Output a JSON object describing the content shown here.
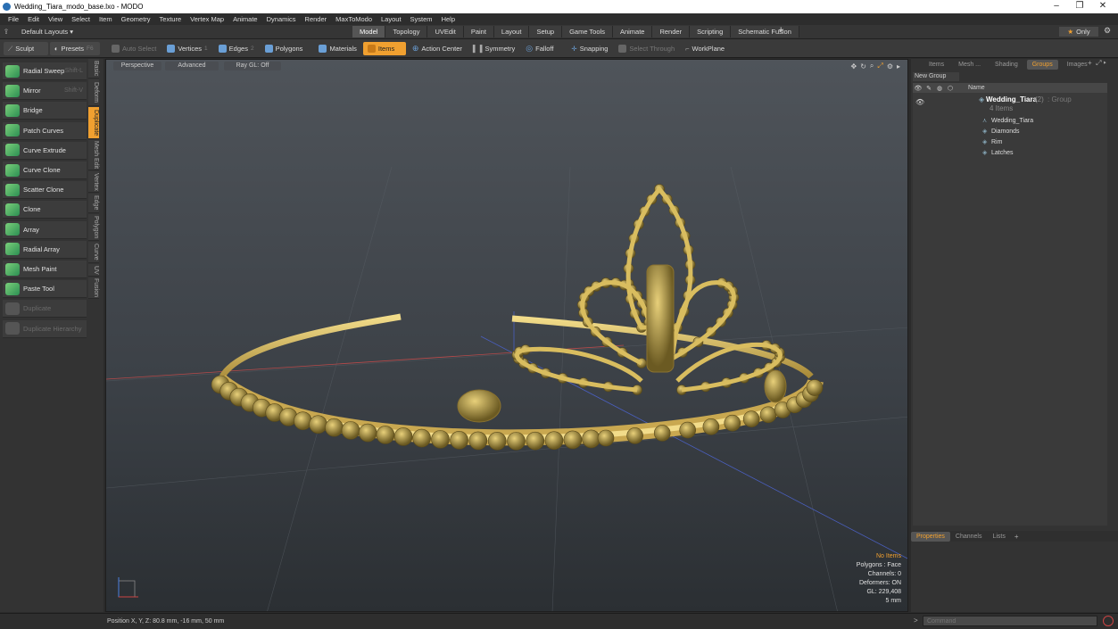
{
  "window": {
    "title": "Wedding_Tiara_modo_base.lxo - MODO"
  },
  "menu": [
    "File",
    "Edit",
    "View",
    "Select",
    "Item",
    "Geometry",
    "Texture",
    "Vertex Map",
    "Animate",
    "Dynamics",
    "Render",
    "MaxToModo",
    "Layout",
    "System",
    "Help"
  ],
  "layouts": {
    "label": "Default Layouts",
    "tabs": [
      "Model",
      "Topology",
      "UVEdit",
      "Paint",
      "Layout",
      "Setup",
      "Game Tools",
      "Animate",
      "Render",
      "Scripting",
      "Schematic Fusion"
    ],
    "active": "Model",
    "only_label": "Only"
  },
  "toolbar": {
    "sculpt": "Sculpt",
    "presets": "Presets",
    "presets_key": "F6",
    "auto_select": "Auto Select",
    "vertices": "Vertices",
    "vertices_key": "1",
    "edges": "Edges",
    "edges_key": "2",
    "polygons": "Polygons",
    "materials": "Materials",
    "items": "Items",
    "action_center": "Action Center",
    "symmetry": "Symmetry",
    "falloff": "Falloff",
    "snapping": "Snapping",
    "select_through": "Select Through",
    "workplane": "WorkPlane"
  },
  "tools": [
    {
      "label": "Radial Sweep",
      "shortcut": "Shift-L"
    },
    {
      "label": "Mirror",
      "shortcut": "Shift-V"
    },
    {
      "label": "Bridge",
      "shortcut": ""
    },
    {
      "label": "Patch Curves",
      "shortcut": ""
    },
    {
      "label": "Curve Extrude",
      "shortcut": ""
    },
    {
      "label": "Curve Clone",
      "shortcut": ""
    },
    {
      "label": "Scatter Clone",
      "shortcut": ""
    },
    {
      "label": "Clone",
      "shortcut": ""
    },
    {
      "label": "Array",
      "shortcut": ""
    },
    {
      "label": "Radial Array",
      "shortcut": ""
    },
    {
      "label": "Mesh Paint",
      "shortcut": ""
    },
    {
      "label": "Paste Tool",
      "shortcut": ""
    },
    {
      "label": "Duplicate",
      "shortcut": ""
    },
    {
      "label": "Duplicate Hierarchy",
      "shortcut": ""
    }
  ],
  "side_tabs": [
    "Basic",
    "Deform",
    "Duplicate",
    "Mesh Edit",
    "Vertex",
    "Edge",
    "Polygon",
    "Curve",
    "UV",
    "Fusion"
  ],
  "viewport": {
    "view": "Perspective",
    "mode": "Advanced",
    "raygl": "Ray GL: Off",
    "info": {
      "no_items": "No Items",
      "polygons": "Polygons : Face",
      "channels": "Channels: 0",
      "deformers": "Deformers: ON",
      "gl": "GL: 229,408",
      "scale": "5 mm"
    }
  },
  "right": {
    "tabs": [
      "Items",
      "Mesh ...",
      "Shading",
      "Groups",
      "Images"
    ],
    "active": "Groups",
    "new_group": "New Group",
    "col_name": "Name",
    "group": {
      "name": "Wedding_Tiara",
      "count": "(2)",
      "type": ": Group",
      "sub": "4 Items"
    },
    "children": [
      "Wedding_Tiara",
      "Diamonds",
      "Rim",
      "Latches"
    ],
    "bottom_tabs": [
      "Properties",
      "Channels",
      "Lists"
    ],
    "bottom_active": "Properties",
    "command_placeholder": "Command"
  },
  "status": {
    "position": "Position X, Y, Z:  80.8 mm, -16 mm, 50 mm"
  }
}
